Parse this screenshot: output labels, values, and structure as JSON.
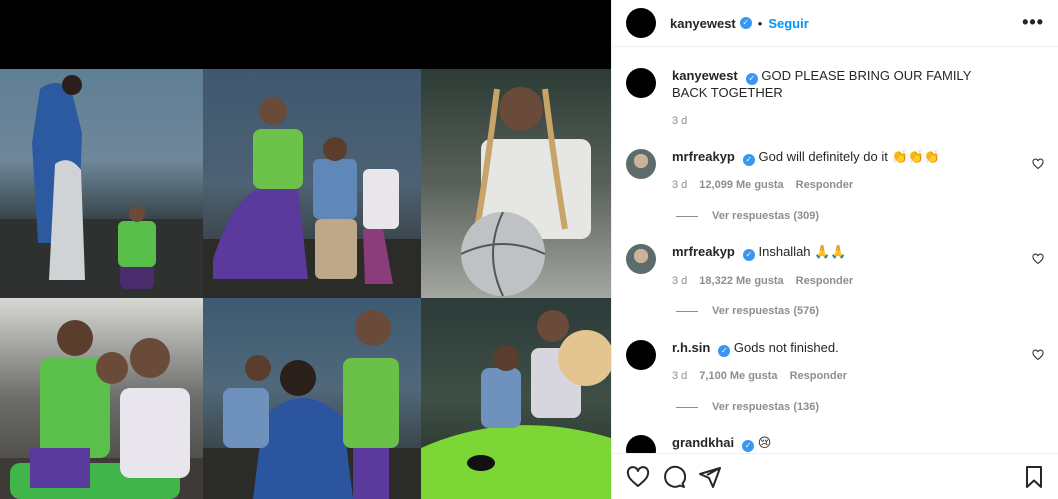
{
  "post": {
    "author": "kanyewest",
    "follow_label": "Seguir",
    "more_label": "•••",
    "caption": "GOD PLEASE BRING OUR FAMILY BACK TOGETHER",
    "caption_time": "3 d"
  },
  "comments": [
    {
      "user": "mrfreakyp",
      "text": "God will definitely do it 👏👏👏",
      "time": "3 d",
      "likes": "12,099 Me gusta",
      "reply": "Responder",
      "view_replies": "Ver respuestas (309)"
    },
    {
      "user": "mrfreakyp",
      "text": "Inshallah 🙏🙏",
      "time": "3 d",
      "likes": "18,322 Me gusta",
      "reply": "Responder",
      "view_replies": "Ver respuestas (576)"
    },
    {
      "user": "r.h.sin",
      "text": "Gods not finished.",
      "time": "3 d",
      "likes": "7,100 Me gusta",
      "reply": "Responder",
      "view_replies": "Ver respuestas (136)"
    },
    {
      "user": "grandkhai",
      "text": "😢"
    }
  ],
  "icons": {
    "verified": "verified-badge-icon",
    "like": "heart-icon",
    "comment": "comment-icon",
    "share": "share-icon",
    "save": "bookmark-icon"
  },
  "colors": {
    "accent": "#0095f6",
    "verified": "#3897f0",
    "muted": "#8e8e8e"
  }
}
